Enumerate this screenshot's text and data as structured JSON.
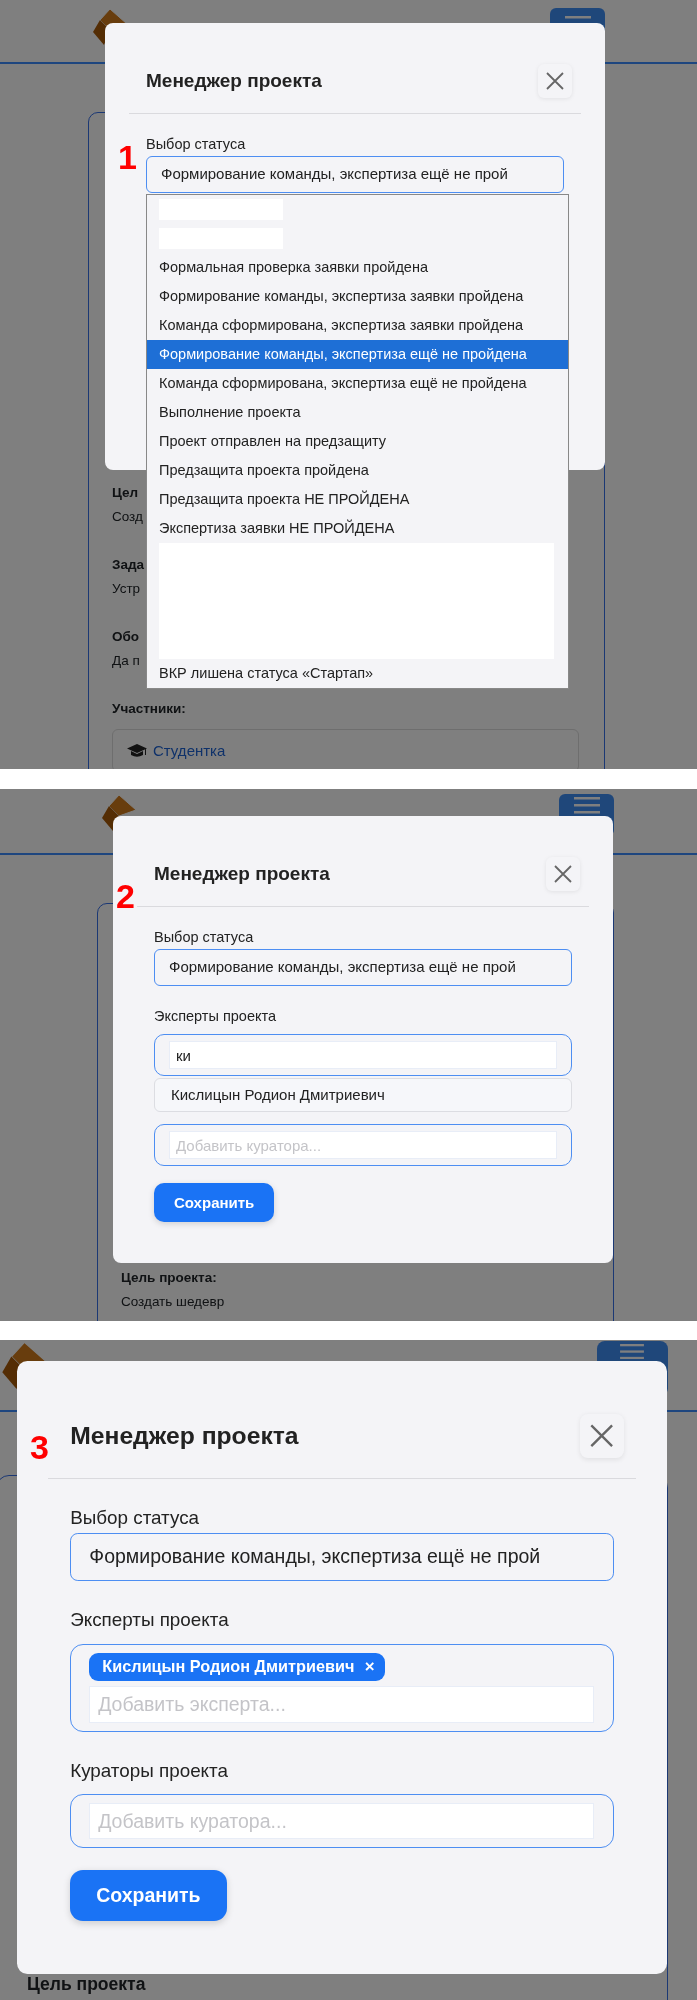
{
  "screens": [
    {
      "annotation": "1",
      "page": {
        "sections": [
          {
            "heading": "Цел",
            "text": "Созд"
          },
          {
            "heading": "Зада",
            "text": "Устр"
          },
          {
            "heading": "Обо",
            "text": "Да п"
          }
        ],
        "participants": {
          "heading": "Участники:",
          "items": [
            "Студентка"
          ]
        }
      },
      "modal": {
        "title": "Менеджер проекта",
        "status_field": {
          "label": "Выбор статуса",
          "value": "Формирование команды, экспертиза ещё не прой",
          "options": [
            {
              "kind": "redacted_line"
            },
            {
              "kind": "redacted_line"
            },
            {
              "kind": "option",
              "label": "Формальная проверка заявки пройдена",
              "selected": false
            },
            {
              "kind": "option",
              "label": "Формирование команды, экспертиза заявки пройдена",
              "selected": false
            },
            {
              "kind": "option",
              "label": "Команда сформирована, экспертиза заявки пройдена",
              "selected": false
            },
            {
              "kind": "option",
              "label": "Формирование команды, экспертиза ещё не пройдена",
              "selected": true
            },
            {
              "kind": "option",
              "label": "Команда сформирована, экспертиза ещё не пройдена",
              "selected": false
            },
            {
              "kind": "option",
              "label": "Выполнение проекта",
              "selected": false
            },
            {
              "kind": "option",
              "label": "Проект отправлен на предзащиту",
              "selected": false
            },
            {
              "kind": "option",
              "label": "Предзащита проекта пройдена",
              "selected": false
            },
            {
              "kind": "option",
              "label": "Предзащита проекта НЕ ПРОЙДЕНА",
              "selected": false
            },
            {
              "kind": "option",
              "label": "Экспертиза заявки НЕ ПРОЙДЕНА",
              "selected": false
            },
            {
              "kind": "redacted_block"
            },
            {
              "kind": "option",
              "label": "ВКР лишена статуса «Стартап»",
              "selected": false
            }
          ]
        }
      }
    },
    {
      "annotation": "2",
      "page": {
        "sections": [
          {
            "heading": "Цель проекта:",
            "text": "Создать шедевр"
          }
        ]
      },
      "modal": {
        "title": "Менеджер проекта",
        "status_field": {
          "label": "Выбор статуса",
          "value": "Формирование команды, экспертиза ещё не прой"
        },
        "experts_field": {
          "label": "Эксперты проекта",
          "value": "ки",
          "suggestions": [
            "Кислицын Родион Дмитриевич"
          ]
        },
        "curators_field": {
          "placeholder": "Добавить куратора..."
        },
        "save_button": "Сохранить"
      }
    },
    {
      "annotation": "3",
      "page": {
        "sections": [
          {
            "heading": "Цель проекта"
          }
        ]
      },
      "modal": {
        "title": "Менеджер проекта",
        "status_field": {
          "label": "Выбор статуса",
          "value": "Формирование команды, экспертиза ещё не прой"
        },
        "experts_field": {
          "label": "Эксперты проекта",
          "tags": [
            {
              "label": "Кислицын Родион Дмитриевич",
              "remove": "×"
            }
          ],
          "placeholder": "Добавить эксперта..."
        },
        "curators_field": {
          "label": "Кураторы проекта",
          "placeholder": "Добавить куратора..."
        },
        "save_button": "Сохранить"
      }
    }
  ]
}
